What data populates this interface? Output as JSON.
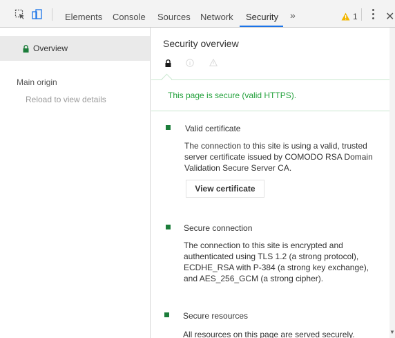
{
  "toolbar": {
    "tabs": [
      {
        "label": "Elements"
      },
      {
        "label": "Console"
      },
      {
        "label": "Sources"
      },
      {
        "label": "Network"
      },
      {
        "label": "Security"
      }
    ],
    "active_tab": "Security",
    "overflow_label": "»",
    "warning_count": "1",
    "icons": [
      "inspect-element-icon",
      "device-toggle-icon",
      "warning-icon",
      "more-options-icon",
      "close-icon"
    ]
  },
  "sidebar": {
    "overview_label": "Overview",
    "origin_heading": "Main origin",
    "reload_hint": "Reload to view details"
  },
  "main": {
    "title": "Security overview",
    "summary": "This page is secure (valid HTTPS).",
    "sections": [
      {
        "title": "Valid certificate",
        "lines": [
          "The connection to this site is using a valid, trusted",
          "server certificate issued by COMODO RSA Domain",
          "Validation Secure Server CA."
        ],
        "button_label": "View certificate"
      },
      {
        "title": "Secure connection",
        "lines": [
          "The connection to this site is encrypted and",
          "authenticated using TLS 1.2 (a strong protocol),",
          "ECDHE_RSA with P-384 (a strong key exchange),",
          "and AES_256_GCM (a strong cipher)."
        ]
      },
      {
        "title": "Secure resources",
        "lines": [
          "All resources on this page are served securely."
        ]
      }
    ]
  },
  "colors": {
    "secure_green": "#21a03a",
    "bullet_green": "#1c7d3a",
    "tab_accent": "#1a73e8",
    "warning_yellow": "#f2b600"
  }
}
